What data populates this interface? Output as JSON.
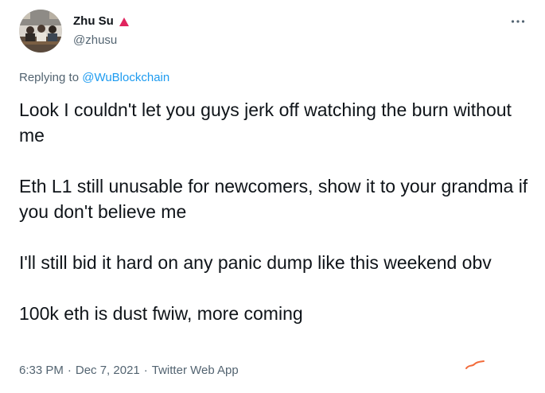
{
  "author": {
    "display_name": "Zhu Su",
    "handle": "@zhusu",
    "badge_color": "#e0245e"
  },
  "more_icon": "ellipsis-icon",
  "reply": {
    "prefix": "Replying to",
    "target": "@WuBlockchain"
  },
  "tweet": {
    "paragraphs": [
      "Look I couldn't let you guys jerk off watching the burn without me",
      "Eth L1 still unusable for newcomers, show it to your grandma if you don't believe me",
      "I'll still bid it hard on any panic dump like this weekend obv",
      "100k eth is dust fwiw, more coming"
    ]
  },
  "meta": {
    "time": "6:33 PM",
    "separator": "·",
    "date": "Dec 7, 2021",
    "source": "Twitter Web App"
  },
  "colors": {
    "text": "#0f1419",
    "secondary": "#536471",
    "link": "#1d9bf0",
    "scribble": "#f26b3a"
  }
}
